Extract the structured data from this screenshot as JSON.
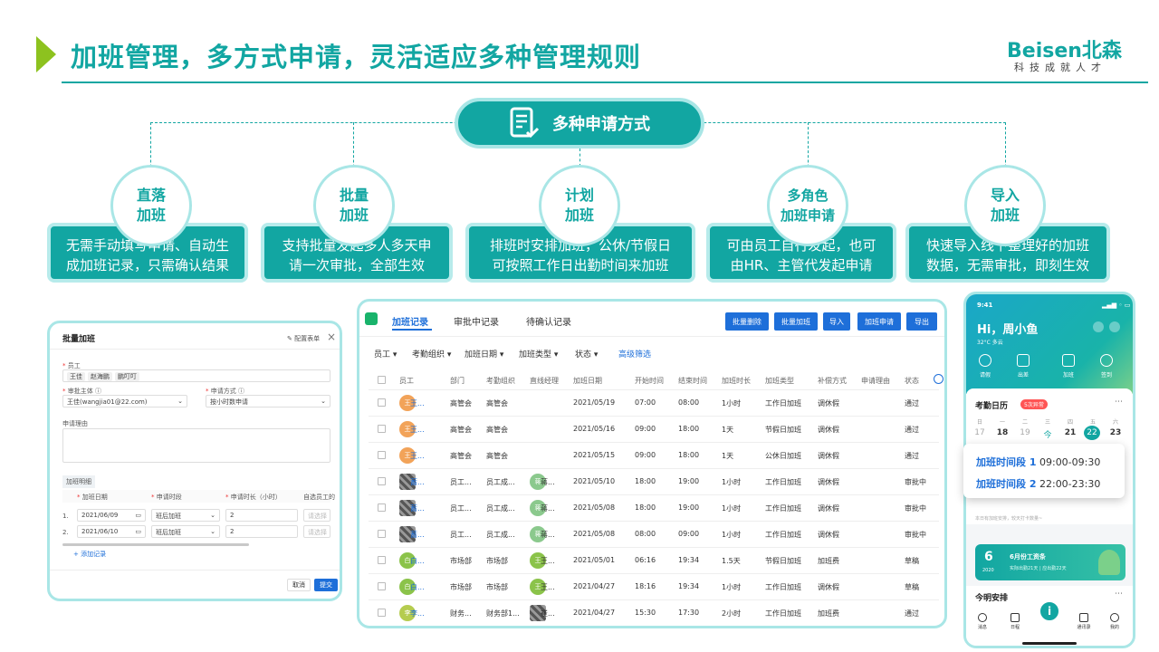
{
  "header": {
    "title": "加班管理，多方式申请，灵活适应多种管理规则",
    "logo_main": "Beisen北森",
    "logo_sub": "科技成就人才"
  },
  "hub": {
    "label": "多种申请方式",
    "icon": "form-check-icon"
  },
  "methods": [
    {
      "title_1": "直落",
      "title_2": "加班",
      "desc_1": "无需手动填写申请、自动生",
      "desc_2": "成加班记录，只需确认结果"
    },
    {
      "title_1": "批量",
      "title_2": "加班",
      "desc_1": "支持批量发起多人多天申",
      "desc_2": "请一次审批，全部生效"
    },
    {
      "title_1": "计划",
      "title_2": "加班",
      "desc_1": "排班时安排加班，公休/节假日",
      "desc_2": "可按照工作日出勤时间来加班"
    },
    {
      "title_1": "多角色",
      "title_2": "加班申请",
      "desc_1": "可由员工自行发起，也可",
      "desc_2": "由HR、主管代发起申请"
    },
    {
      "title_1": "导入",
      "title_2": "加班",
      "desc_1": "快速导入线下整理好的加班",
      "desc_2": "数据，无需审批，即刻生效"
    }
  ],
  "batch_form": {
    "title": "批量加班",
    "config_label": "配置表单",
    "employee_label": "员工",
    "employees": [
      "王佳",
      "赵海鹏",
      "鹏叮叮"
    ],
    "approver_label": "审批主体",
    "approver_value": "王佳(wangjia01@22.com)",
    "method_label": "申请方式",
    "method_value": "按小时数申请",
    "reason_label": "申请理由",
    "detail_label": "加班明细",
    "col_date": "加班日期",
    "col_period": "申请时段",
    "col_hours": "申请时长（小时）",
    "col_auto": "自选员工的",
    "rows": [
      {
        "idx": "1.",
        "date": "2021/06/09",
        "period": "班后加班",
        "hours": "2",
        "pick": "请选择"
      },
      {
        "idx": "2.",
        "date": "2021/06/10",
        "period": "班后加班",
        "hours": "2",
        "pick": "请选择"
      }
    ],
    "add_label": "+ 添加记录",
    "cancel_label": "取消",
    "submit_label": "提交"
  },
  "records": {
    "tabs": [
      "加班记录",
      "审批中记录",
      "待确认记录"
    ],
    "buttons": [
      "批量删除",
      "批量加班",
      "导入",
      "加班申请",
      "导出"
    ],
    "filters": [
      "员工",
      "考勤组织",
      "加班日期",
      "加班类型",
      "状态"
    ],
    "advanced": "高级筛选",
    "headers": [
      "员工",
      "部门",
      "考勤组织",
      "直线经理",
      "加班日期",
      "开始时间",
      "结束时间",
      "加班时长",
      "加班类型",
      "补偿方式",
      "申请理由",
      "状态"
    ],
    "rows": [
      {
        "av": "王",
        "avc": "#f2a359",
        "emp": "王...",
        "dept": "高管会",
        "org": "高管会",
        "mgr": "",
        "mav": "",
        "date": "2021/05/19",
        "start": "07:00",
        "end": "08:00",
        "dur": "1小时",
        "type": "工作日加班",
        "comp": "调休假",
        "status": "通过"
      },
      {
        "av": "王",
        "avc": "#f2a359",
        "emp": "王...",
        "dept": "高管会",
        "org": "高管会",
        "mgr": "",
        "mav": "",
        "date": "2021/05/16",
        "start": "09:00",
        "end": "18:00",
        "dur": "1天",
        "type": "节假日加班",
        "comp": "调休假",
        "status": "通过"
      },
      {
        "av": "王",
        "avc": "#f2a359",
        "emp": "王...",
        "dept": "高管会",
        "org": "高管会",
        "mgr": "",
        "mav": "",
        "date": "2021/05/15",
        "start": "09:00",
        "end": "18:00",
        "dur": "1天",
        "type": "公休日加班",
        "comp": "调休假",
        "status": "通过"
      },
      {
        "av": "",
        "avc": "#777777",
        "emp": "蓄...",
        "dept": "员工...",
        "org": "员工成...",
        "mgr": "蒋...",
        "mav": "蒋",
        "date": "2021/05/10",
        "start": "18:00",
        "end": "19:00",
        "dur": "1小时",
        "type": "工作日加班",
        "comp": "调休假",
        "status": "审批中"
      },
      {
        "av": "",
        "avc": "#777777",
        "emp": "蓄...",
        "dept": "员工...",
        "org": "员工成...",
        "mgr": "蒋...",
        "mav": "蒋",
        "date": "2021/05/08",
        "start": "18:00",
        "end": "19:00",
        "dur": "1小时",
        "type": "工作日加班",
        "comp": "调休假",
        "status": "审批中"
      },
      {
        "av": "",
        "avc": "#777777",
        "emp": "蓄...",
        "dept": "员工...",
        "org": "员工成...",
        "mgr": "蒋...",
        "mav": "蒋",
        "date": "2021/05/08",
        "start": "08:00",
        "end": "09:00",
        "dur": "1小时",
        "type": "工作日加班",
        "comp": "调休假",
        "status": "审批中"
      },
      {
        "av": "白",
        "avc": "#8bc34a",
        "emp": "白...",
        "dept": "市场部",
        "org": "市场部",
        "mgr": "王...",
        "mav": "王",
        "date": "2021/05/01",
        "start": "06:16",
        "end": "19:34",
        "dur": "1.5天",
        "type": "节假日加班",
        "comp": "加班费",
        "status": "草稿"
      },
      {
        "av": "白",
        "avc": "#8bc34a",
        "emp": "白...",
        "dept": "市场部",
        "org": "市场部",
        "mgr": "王...",
        "mav": "王",
        "date": "2021/04/27",
        "start": "18:16",
        "end": "19:34",
        "dur": "1小时",
        "type": "工作日加班",
        "comp": "调休假",
        "status": "草稿"
      },
      {
        "av": "李",
        "avc": "#b5cc4f",
        "emp": "李...",
        "dept": "财务...",
        "org": "财务部1...",
        "mgr": "崔...",
        "mav": "",
        "date": "2021/04/27",
        "start": "15:30",
        "end": "17:30",
        "dur": "2小时",
        "type": "工作日加班",
        "comp": "加班费",
        "status": "通过"
      }
    ]
  },
  "phone": {
    "time": "9:41",
    "greeting": "Hi，周小鱼",
    "weather": "32°C  多云",
    "quick": [
      "请假",
      "出差",
      "加班",
      "签到"
    ],
    "calendar_title": "考勤日历",
    "calendar_badge": "5次异常",
    "weekdays": [
      "日",
      "一",
      "二",
      "三",
      "四",
      "五",
      "六"
    ],
    "days": [
      "17",
      "18",
      "19",
      "今",
      "21",
      "22",
      "23"
    ],
    "note": "本日有加班安排，较天打卡数量~",
    "pay_day": "6",
    "pay_year": "2020",
    "pay_title": "6月份工资条",
    "pay_sub": "实际出勤21天 | 应出勤22天",
    "plan_title": "今明安排",
    "nav": [
      "消息",
      "日程",
      "",
      "通讯录",
      "我的"
    ]
  },
  "popup": {
    "line1_label": "加班时间段 1",
    "line1_time": "09:00-09:30",
    "line2_label": "加班时间段 2",
    "line2_time": "22:00-23:30"
  }
}
